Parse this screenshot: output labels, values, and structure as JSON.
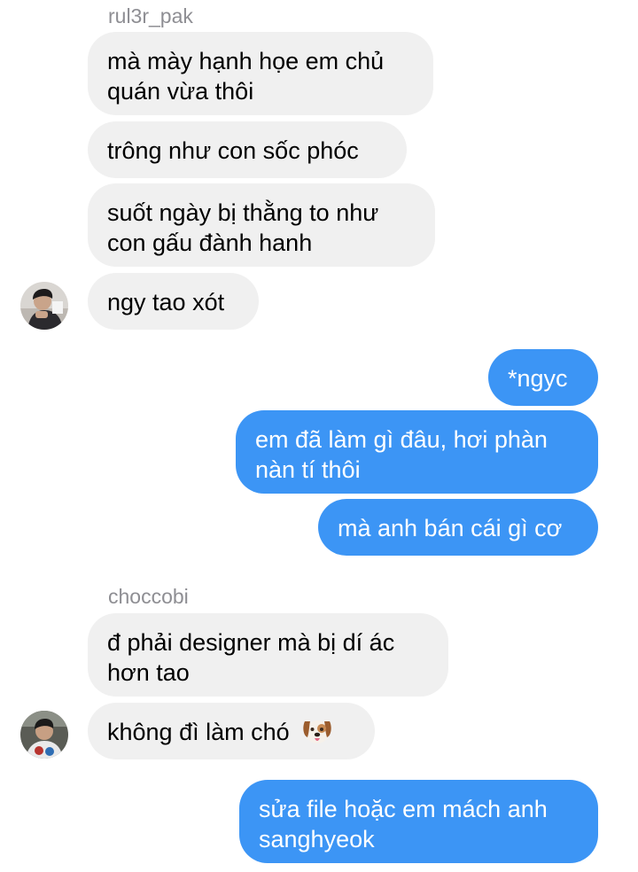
{
  "conversation": {
    "groups": [
      {
        "sender": "rul3r_pak",
        "messages": [
          {
            "lines": [
              "mà mày hạnh họe em chủ",
              "quán vừa thôi"
            ]
          },
          {
            "lines": [
              "trông như con sốc phóc"
            ]
          },
          {
            "lines": [
              "suốt ngày bị thằng to như",
              "con gấu đành hanh"
            ]
          },
          {
            "lines": [
              "ngy tao xót"
            ]
          }
        ]
      },
      {
        "sender": "me",
        "messages": [
          {
            "lines": [
              "*ngyc"
            ]
          },
          {
            "lines": [
              "em đã làm gì đâu, hơi phàn",
              "nàn tí thôi"
            ]
          },
          {
            "lines": [
              "mà anh bán cái gì cơ"
            ]
          }
        ]
      },
      {
        "sender": "choccobi",
        "messages": [
          {
            "lines": [
              "đ phải designer mà bị dí ác",
              "hơn tao"
            ]
          },
          {
            "lines": [
              "không đì làm chó"
            ],
            "emoji": "dog-face-emoji"
          }
        ]
      },
      {
        "sender": "me",
        "messages": [
          {
            "lines": [
              "sửa file hoặc em mách anh",
              "sanghyeok"
            ]
          }
        ]
      }
    ]
  },
  "colors": {
    "incoming_bubble": "#f0f0f0",
    "outgoing_bubble": "#3c95f5",
    "sender_name": "#8e8e93"
  }
}
